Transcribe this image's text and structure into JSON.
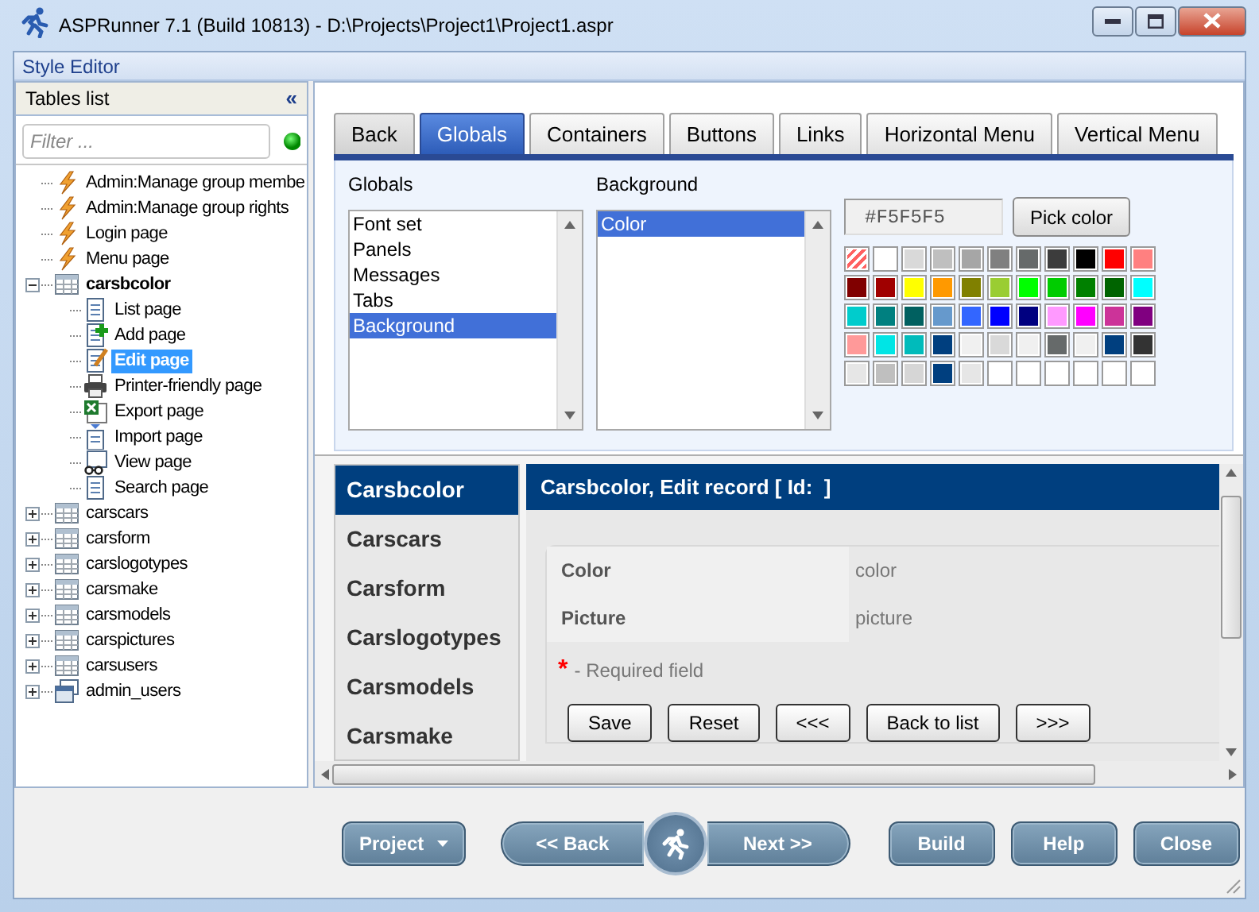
{
  "window": {
    "title": "ASPRunner 7.1 (Build 10813) - D:\\Projects\\Project1\\Project1.aspr"
  },
  "menu_bar": {
    "label": "Style Editor"
  },
  "tables_panel": {
    "title": "Tables list",
    "collapse_glyph": "«",
    "filter": {
      "placeholder": "Filter ..."
    },
    "tree": [
      {
        "label": "Admin:Manage group membe",
        "kind": "event",
        "selected": false
      },
      {
        "label": "Admin:Manage group rights",
        "kind": "event",
        "selected": false
      },
      {
        "label": "Login page",
        "kind": "event",
        "selected": false
      },
      {
        "label": "Menu page",
        "kind": "event",
        "selected": false
      },
      {
        "label": "carsbcolor",
        "kind": "table",
        "expanded": true,
        "selected": false,
        "children": [
          {
            "label": "List page",
            "kind": "list",
            "selected": false
          },
          {
            "label": "Add page",
            "kind": "add",
            "selected": false
          },
          {
            "label": "Edit page",
            "kind": "edit",
            "selected": true
          },
          {
            "label": "Printer-friendly page",
            "kind": "print",
            "selected": false
          },
          {
            "label": "Export page",
            "kind": "export",
            "selected": false
          },
          {
            "label": "Import page",
            "kind": "import",
            "selected": false
          },
          {
            "label": "View page",
            "kind": "view",
            "selected": false
          },
          {
            "label": "Search page",
            "kind": "list",
            "selected": false
          }
        ]
      },
      {
        "label": "carscars",
        "kind": "table",
        "expanded": false,
        "selected": false
      },
      {
        "label": "carsform",
        "kind": "table",
        "expanded": false,
        "selected": false
      },
      {
        "label": "carslogotypes",
        "kind": "table",
        "expanded": false,
        "selected": false
      },
      {
        "label": "carsmake",
        "kind": "table",
        "expanded": false,
        "selected": false
      },
      {
        "label": "carsmodels",
        "kind": "table",
        "expanded": false,
        "selected": false
      },
      {
        "label": "carspictures",
        "kind": "table",
        "expanded": false,
        "selected": false
      },
      {
        "label": "carsusers",
        "kind": "table",
        "expanded": false,
        "selected": false
      },
      {
        "label": "admin_users",
        "kind": "admin",
        "expanded": false,
        "selected": false
      }
    ]
  },
  "style_tabs": [
    {
      "label": "Back",
      "selected": false
    },
    {
      "label": "Globals",
      "selected": true
    },
    {
      "label": "Containers",
      "selected": false
    },
    {
      "label": "Buttons",
      "selected": false
    },
    {
      "label": "Links",
      "selected": false
    },
    {
      "label": "Horizontal Menu",
      "selected": false
    },
    {
      "label": "Vertical Menu",
      "selected": false
    }
  ],
  "style_panel": {
    "globals": {
      "title": "Globals",
      "items": [
        {
          "label": "Font set",
          "selected": false
        },
        {
          "label": "Panels",
          "selected": false
        },
        {
          "label": "Messages",
          "selected": false
        },
        {
          "label": "Tabs",
          "selected": false
        },
        {
          "label": "Background",
          "selected": true
        }
      ]
    },
    "background": {
      "title": "Background",
      "items": [
        {
          "label": "Color",
          "selected": true
        }
      ]
    },
    "color_value": "#F5F5F5",
    "pick_button": "Pick color",
    "swatches": [
      {
        "kind": "transparent"
      },
      {
        "kind": "solid",
        "color": "#ffffff"
      },
      {
        "kind": "solid",
        "color": "#d9d9d9"
      },
      {
        "kind": "solid",
        "color": "#bfbfbf"
      },
      {
        "kind": "solid",
        "color": "#a6a6a6"
      },
      {
        "kind": "solid",
        "color": "#808080"
      },
      {
        "kind": "solid",
        "color": "#666a6a"
      },
      {
        "kind": "solid",
        "color": "#3c3c3c"
      },
      {
        "kind": "solid",
        "color": "#000000"
      },
      {
        "kind": "solid",
        "color": "#ff0000"
      },
      {
        "kind": "solid",
        "color": "#ff8080"
      },
      {
        "kind": "solid",
        "color": "#800000"
      },
      {
        "kind": "solid",
        "color": "#a00000"
      },
      {
        "kind": "solid",
        "color": "#ffff00"
      },
      {
        "kind": "solid",
        "color": "#ff9900"
      },
      {
        "kind": "solid",
        "color": "#808000"
      },
      {
        "kind": "solid",
        "color": "#9acd32"
      },
      {
        "kind": "solid",
        "color": "#00ff00"
      },
      {
        "kind": "solid",
        "color": "#00cc00"
      },
      {
        "kind": "solid",
        "color": "#008000"
      },
      {
        "kind": "solid",
        "color": "#006400"
      },
      {
        "kind": "solid",
        "color": "#00ffff"
      },
      {
        "kind": "solid",
        "color": "#00cccc"
      },
      {
        "kind": "solid",
        "color": "#008080"
      },
      {
        "kind": "solid",
        "color": "#006060"
      },
      {
        "kind": "solid",
        "color": "#6699cc"
      },
      {
        "kind": "solid",
        "color": "#3366ff"
      },
      {
        "kind": "solid",
        "color": "#0000ff"
      },
      {
        "kind": "solid",
        "color": "#000080"
      },
      {
        "kind": "solid",
        "color": "#ff99ff"
      },
      {
        "kind": "solid",
        "color": "#ff00ff"
      },
      {
        "kind": "solid",
        "color": "#cc3399"
      },
      {
        "kind": "solid",
        "color": "#800080"
      },
      {
        "kind": "solid",
        "color": "#ff9999"
      },
      {
        "kind": "solid",
        "color": "#00e5e5"
      },
      {
        "kind": "solid",
        "color": "#00bbbb"
      },
      {
        "kind": "solid",
        "color": "#003f7f"
      },
      {
        "kind": "solid",
        "color": "#f0f0f0"
      },
      {
        "kind": "solid",
        "color": "#d9d9d9"
      },
      {
        "kind": "solid",
        "color": "#f0f0f0"
      },
      {
        "kind": "solid",
        "color": "#666a6a"
      },
      {
        "kind": "solid",
        "color": "#f0f0f0"
      },
      {
        "kind": "solid",
        "color": "#003f7f"
      },
      {
        "kind": "solid",
        "color": "#333333"
      },
      {
        "kind": "solid",
        "color": "#e6e6e6"
      },
      {
        "kind": "solid",
        "color": "#bfbfbf"
      },
      {
        "kind": "solid",
        "color": "#d6d6d6"
      },
      {
        "kind": "solid",
        "color": "#003f7f"
      },
      {
        "kind": "solid",
        "color": "#e6e6e6"
      },
      {
        "kind": "solid",
        "color": "#ffffff"
      },
      {
        "kind": "solid",
        "color": "#ffffff"
      },
      {
        "kind": "solid",
        "color": "#ffffff"
      },
      {
        "kind": "solid",
        "color": "#ffffff"
      },
      {
        "kind": "solid",
        "color": "#ffffff"
      },
      {
        "kind": "solid",
        "color": "#ffffff"
      }
    ]
  },
  "preview": {
    "menu": [
      {
        "label": "Carsbcolor",
        "selected": true
      },
      {
        "label": "Carscars",
        "selected": false
      },
      {
        "label": "Carsform",
        "selected": false
      },
      {
        "label": "Carslogotypes",
        "selected": false
      },
      {
        "label": "Carsmodels",
        "selected": false
      },
      {
        "label": "Carsmake",
        "selected": false
      }
    ],
    "header": "Carsbcolor, Edit record [ Id:  ]",
    "fields": [
      {
        "label": "Color",
        "value": "color"
      },
      {
        "label": "Picture",
        "value": "picture"
      }
    ],
    "required_mark": "*",
    "required_text": "- Required field",
    "buttons": [
      "Save",
      "Reset",
      "<<<",
      "Back to list",
      ">>>"
    ]
  },
  "footer_buttons": [
    {
      "label": "Project",
      "kind": "dropdown"
    },
    {
      "label": "<< Back",
      "kind": "back"
    },
    {
      "label": "Next >>",
      "kind": "next"
    },
    {
      "label": "Build",
      "kind": "plain"
    },
    {
      "label": "Help",
      "kind": "plain"
    },
    {
      "label": "Close",
      "kind": "plain"
    }
  ]
}
